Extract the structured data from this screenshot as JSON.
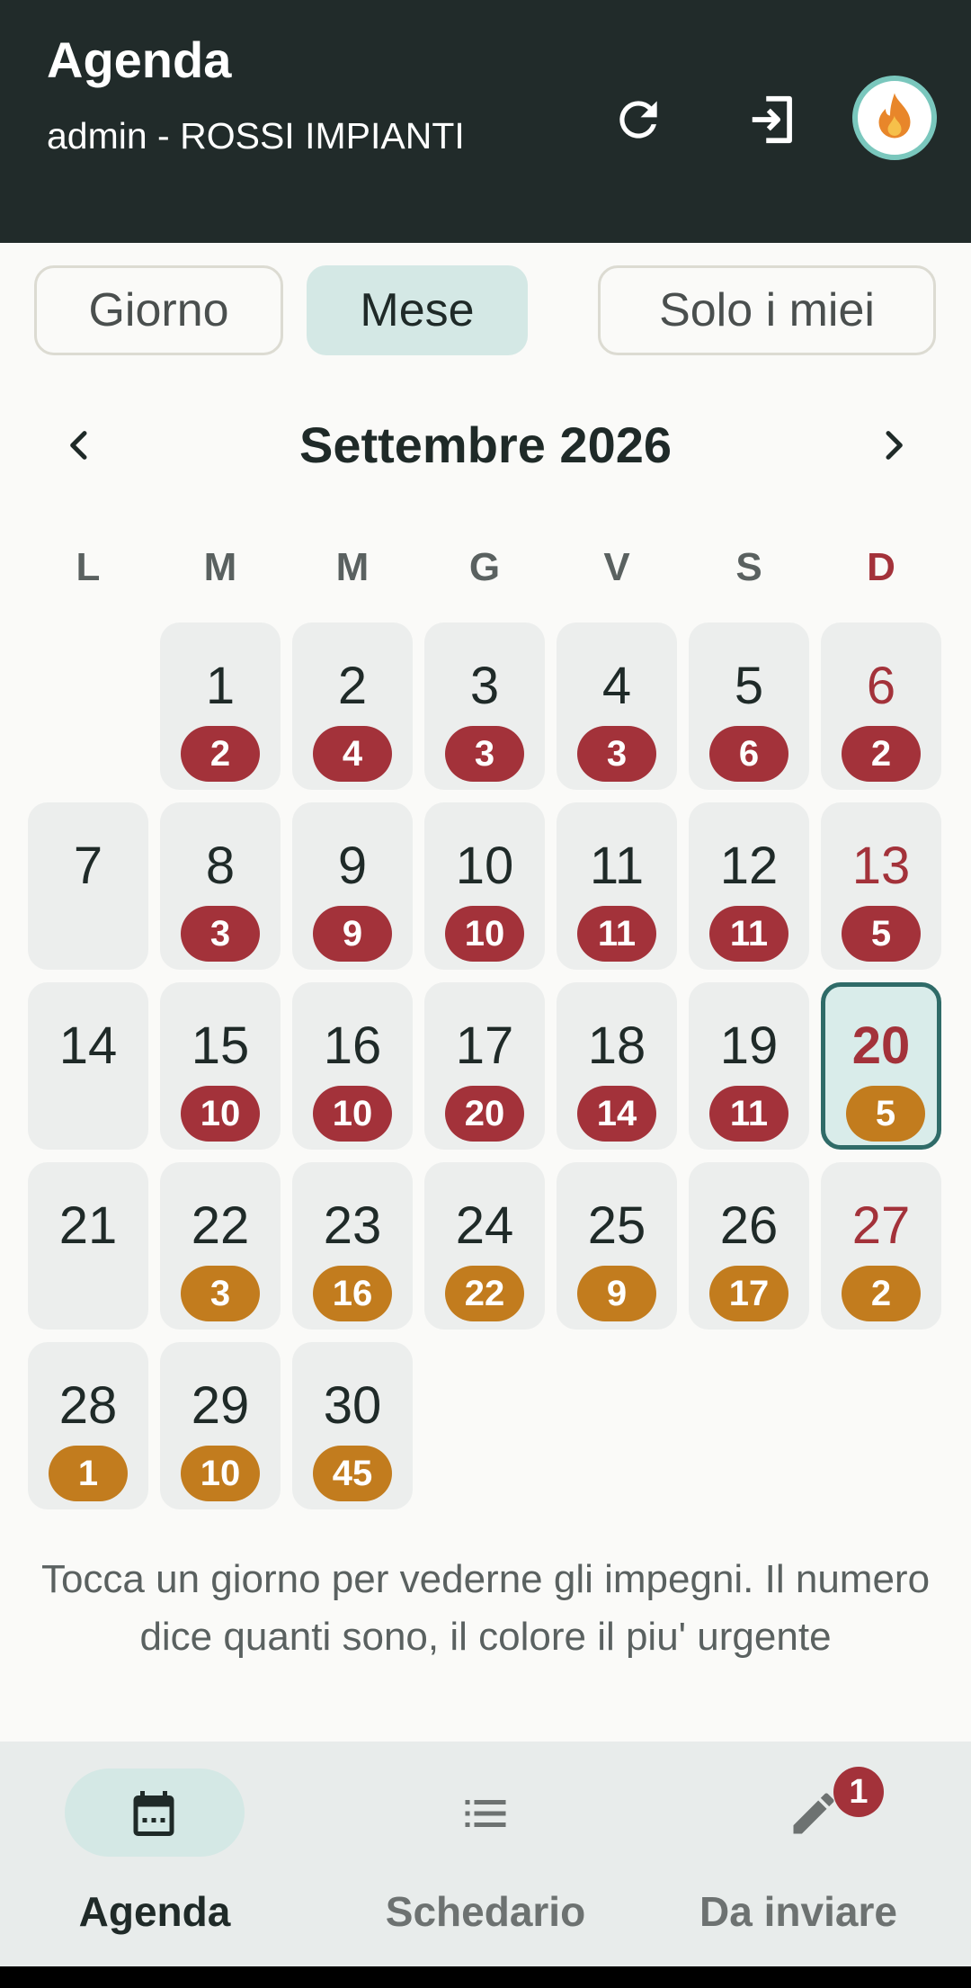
{
  "header": {
    "title": "Agenda",
    "subtitle": "admin - ROSSI IMPIANTI",
    "refresh_icon": "refresh-icon",
    "logout_icon": "logout-icon",
    "avatar_icon": "flame-icon"
  },
  "segments": {
    "day": "Giorno",
    "month": "Mese",
    "mine": "Solo i miei",
    "selected": "month"
  },
  "calendar": {
    "title": "Settembre 2026",
    "weekdays": [
      "L",
      "M",
      "M",
      "G",
      "V",
      "S",
      "D"
    ],
    "first_weekday_index": 1,
    "today": 20,
    "days": [
      {
        "day": "1",
        "count": "2",
        "urgency": "red"
      },
      {
        "day": "2",
        "count": "4",
        "urgency": "red"
      },
      {
        "day": "3",
        "count": "3",
        "urgency": "red"
      },
      {
        "day": "4",
        "count": "3",
        "urgency": "red"
      },
      {
        "day": "5",
        "count": "6",
        "urgency": "red"
      },
      {
        "day": "6",
        "count": "2",
        "urgency": "red"
      },
      {
        "day": "7",
        "count": null,
        "urgency": null
      },
      {
        "day": "8",
        "count": "3",
        "urgency": "red"
      },
      {
        "day": "9",
        "count": "9",
        "urgency": "red"
      },
      {
        "day": "10",
        "count": "10",
        "urgency": "red"
      },
      {
        "day": "11",
        "count": "11",
        "urgency": "red"
      },
      {
        "day": "12",
        "count": "11",
        "urgency": "red"
      },
      {
        "day": "13",
        "count": "5",
        "urgency": "red"
      },
      {
        "day": "14",
        "count": null,
        "urgency": null
      },
      {
        "day": "15",
        "count": "10",
        "urgency": "red"
      },
      {
        "day": "16",
        "count": "10",
        "urgency": "red"
      },
      {
        "day": "17",
        "count": "20",
        "urgency": "red"
      },
      {
        "day": "18",
        "count": "14",
        "urgency": "red"
      },
      {
        "day": "19",
        "count": "11",
        "urgency": "red"
      },
      {
        "day": "20",
        "count": "5",
        "urgency": "amber"
      },
      {
        "day": "21",
        "count": null,
        "urgency": null
      },
      {
        "day": "22",
        "count": "3",
        "urgency": "amber"
      },
      {
        "day": "23",
        "count": "16",
        "urgency": "amber"
      },
      {
        "day": "24",
        "count": "22",
        "urgency": "amber"
      },
      {
        "day": "25",
        "count": "9",
        "urgency": "amber"
      },
      {
        "day": "26",
        "count": "17",
        "urgency": "amber"
      },
      {
        "day": "27",
        "count": "2",
        "urgency": "amber"
      },
      {
        "day": "28",
        "count": "1",
        "urgency": "amber"
      },
      {
        "day": "29",
        "count": "10",
        "urgency": "amber"
      },
      {
        "day": "30",
        "count": "45",
        "urgency": "amber"
      }
    ]
  },
  "hint": "Tocca un giorno per vederne gli impegni. Il numero dice quanti sono, il colore il piu' urgente",
  "bottom_nav": {
    "agenda_label": "Agenda",
    "schedario_label": "Schedario",
    "inviare_label": "Da inviare",
    "inviare_badge": "1",
    "selected": "agenda"
  },
  "colors": {
    "header_bg": "#212b2a",
    "accent": "#d4e8e5",
    "urgent_red": "#a3323a",
    "urgent_amber": "#c27c1e",
    "today_border": "#2f6b68"
  }
}
